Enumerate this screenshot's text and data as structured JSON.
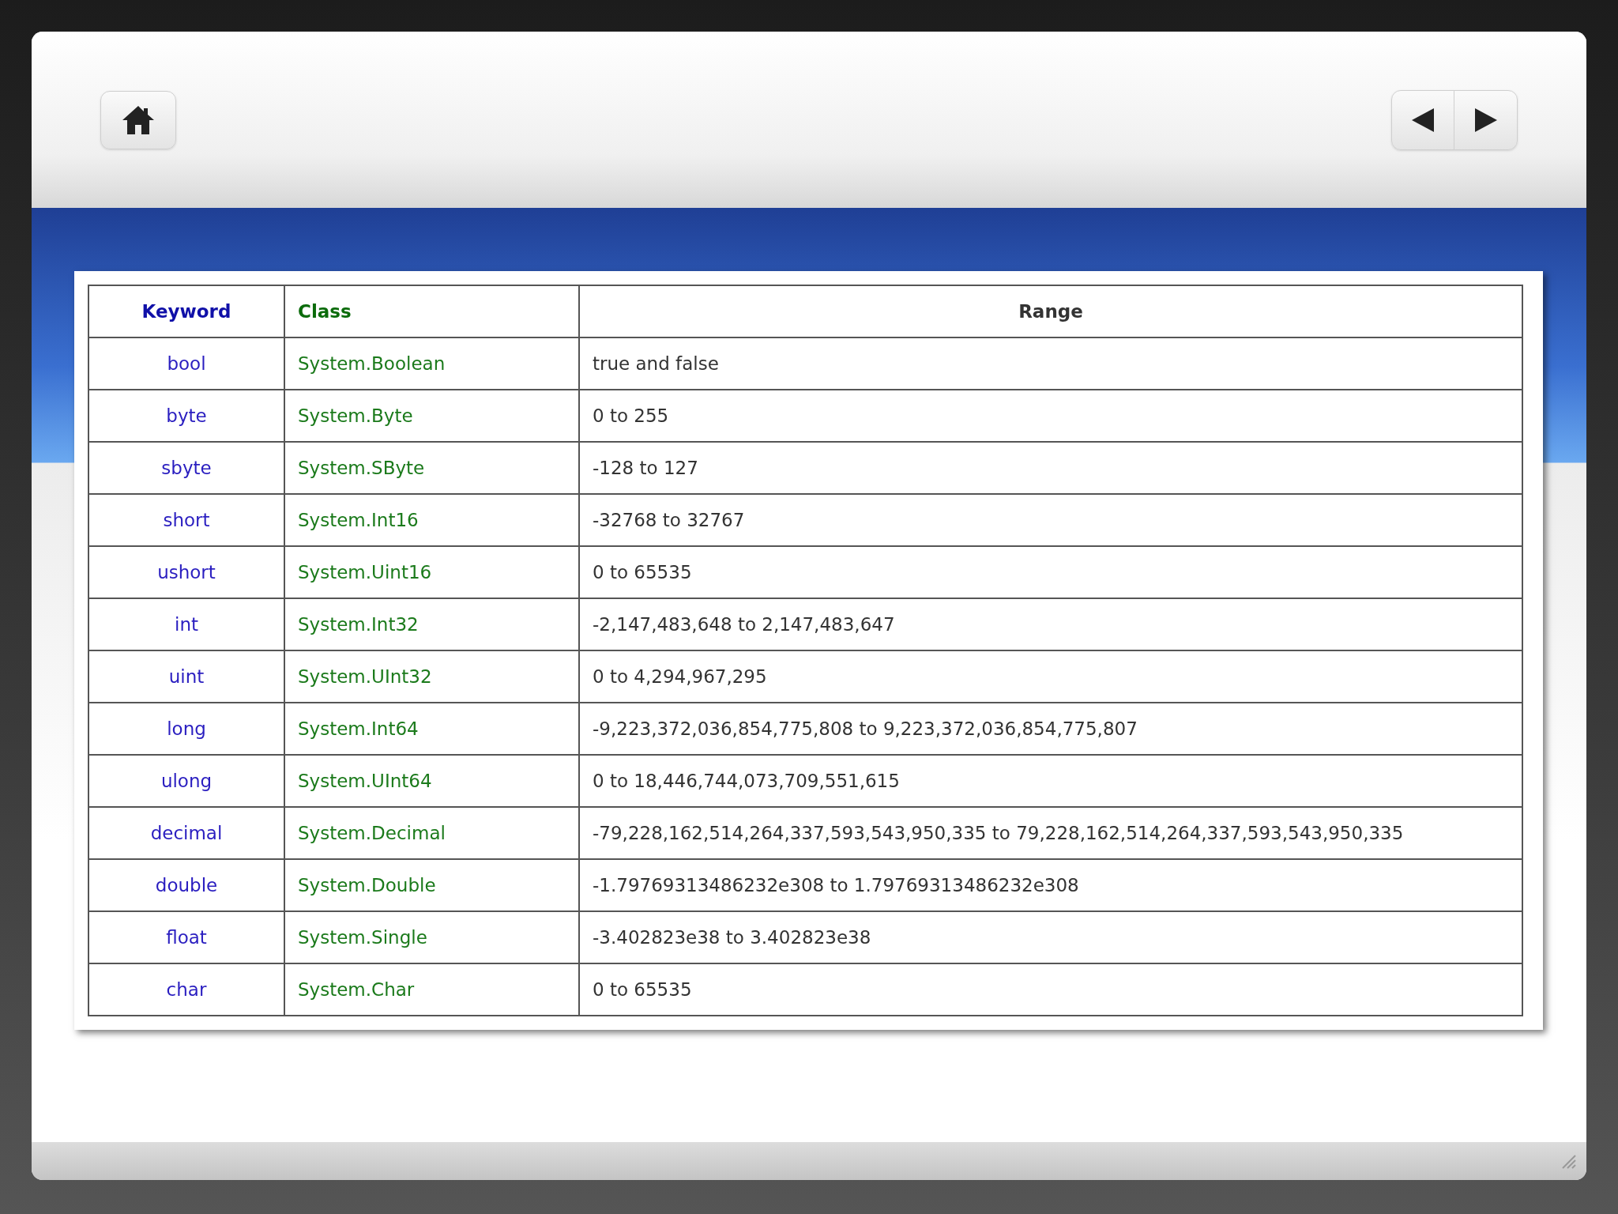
{
  "table": {
    "columns": [
      "Keyword",
      "Class",
      "Range"
    ],
    "rows": [
      {
        "keyword": "bool",
        "class": "System.Boolean",
        "range": "true and false"
      },
      {
        "keyword": "byte",
        "class": "System.Byte",
        "range": "0 to 255"
      },
      {
        "keyword": "sbyte",
        "class": "System.SByte",
        "range": "-128 to 127"
      },
      {
        "keyword": "short",
        "class": "System.Int16",
        "range": "-32768 to 32767"
      },
      {
        "keyword": "ushort",
        "class": "System.Uint16",
        "range": "0 to 65535"
      },
      {
        "keyword": "int",
        "class": "System.Int32",
        "range": "-2,147,483,648 to 2,147,483,647"
      },
      {
        "keyword": "uint",
        "class": "System.UInt32",
        "range": "0 to 4,294,967,295"
      },
      {
        "keyword": "long",
        "class": "System.Int64",
        "range": "-9,223,372,036,854,775,808 to 9,223,372,036,854,775,807"
      },
      {
        "keyword": "ulong",
        "class": "System.UInt64",
        "range": "0 to 18,446,744,073,709,551,615"
      },
      {
        "keyword": "decimal",
        "class": "System.Decimal",
        "range": "-79,228,162,514,264,337,593,543,950,335 to 79,228,162,514,264,337,593,543,950,335"
      },
      {
        "keyword": "double",
        "class": "System.Double",
        "range": "-1.79769313486232e308 to 1.79769313486232e308"
      },
      {
        "keyword": "float",
        "class": "System.Single",
        "range": "-3.402823e38 to 3.402823e38"
      },
      {
        "keyword": "char",
        "class": "System.Char",
        "range": "0 to 65535"
      }
    ]
  }
}
